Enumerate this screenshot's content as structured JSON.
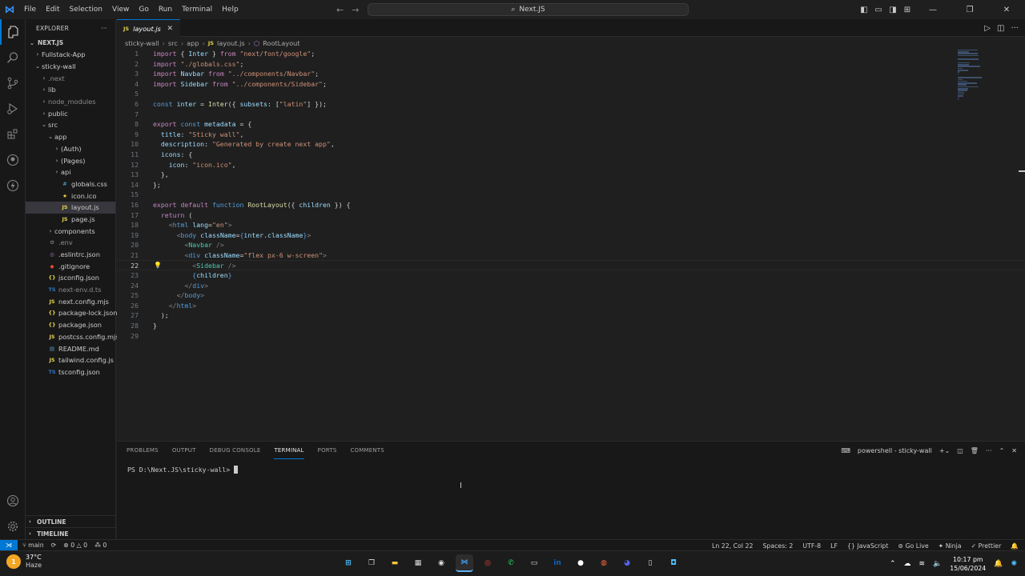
{
  "titlebar": {
    "menu": [
      "File",
      "Edit",
      "Selection",
      "View",
      "Go",
      "Run",
      "Terminal",
      "Help"
    ],
    "search": "Next.JS"
  },
  "explorer": {
    "title": "EXPLORER",
    "root": "NEXT.JS",
    "items": [
      {
        "label": "Fullstack-App",
        "depth": 1,
        "type": "folder",
        "open": false
      },
      {
        "label": "sticky-wall",
        "depth": 1,
        "type": "folder",
        "open": true
      },
      {
        "label": ".next",
        "depth": 2,
        "type": "folder",
        "open": false,
        "dim": true
      },
      {
        "label": "lib",
        "depth": 2,
        "type": "folder",
        "open": false
      },
      {
        "label": "node_modules",
        "depth": 2,
        "type": "folder",
        "open": false,
        "dim": true
      },
      {
        "label": "public",
        "depth": 2,
        "type": "folder",
        "open": false
      },
      {
        "label": "src",
        "depth": 2,
        "type": "folder",
        "open": true
      },
      {
        "label": "app",
        "depth": 3,
        "type": "folder",
        "open": true
      },
      {
        "label": "(Auth)",
        "depth": 4,
        "type": "folder",
        "open": false
      },
      {
        "label": "(Pages)",
        "depth": 4,
        "type": "folder",
        "open": false
      },
      {
        "label": "api",
        "depth": 4,
        "type": "folder",
        "open": false
      },
      {
        "label": "globals.css",
        "depth": 4,
        "type": "css"
      },
      {
        "label": "icon.ico",
        "depth": 4,
        "type": "ico"
      },
      {
        "label": "layout.js",
        "depth": 4,
        "type": "js",
        "selected": true
      },
      {
        "label": "page.js",
        "depth": 4,
        "type": "js"
      },
      {
        "label": "components",
        "depth": 3,
        "type": "folder",
        "open": false
      },
      {
        "label": ".env",
        "depth": 2,
        "type": "env",
        "dim": true
      },
      {
        "label": ".eslintrc.json",
        "depth": 2,
        "type": "eslint"
      },
      {
        "label": ".gitignore",
        "depth": 2,
        "type": "git"
      },
      {
        "label": "jsconfig.json",
        "depth": 2,
        "type": "json"
      },
      {
        "label": "next-env.d.ts",
        "depth": 2,
        "type": "ts",
        "dim": true
      },
      {
        "label": "next.config.mjs",
        "depth": 2,
        "type": "js"
      },
      {
        "label": "package-lock.json",
        "depth": 2,
        "type": "json"
      },
      {
        "label": "package.json",
        "depth": 2,
        "type": "json"
      },
      {
        "label": "postcss.config.mjs",
        "depth": 2,
        "type": "js"
      },
      {
        "label": "README.md",
        "depth": 2,
        "type": "md"
      },
      {
        "label": "tailwind.config.js",
        "depth": 2,
        "type": "js"
      },
      {
        "label": "tsconfig.json",
        "depth": 2,
        "type": "ts"
      }
    ],
    "outline": "OUTLINE",
    "timeline": "TIMELINE"
  },
  "editor": {
    "tab": "layout.js",
    "breadcrumb": [
      "sticky-wall",
      "src",
      "app",
      "layout.js",
      "RootLayout"
    ],
    "current_line": 22,
    "lines": [
      [
        [
          "kw",
          "import "
        ],
        [
          "p",
          "{ "
        ],
        [
          "v",
          "Inter"
        ],
        [
          "p",
          " } "
        ],
        [
          "kw",
          "from "
        ],
        [
          "s",
          "\"next/font/google\""
        ],
        [
          "p",
          ";"
        ]
      ],
      [
        [
          "kw",
          "import "
        ],
        [
          "s",
          "\"./globals.css\""
        ],
        [
          "p",
          ";"
        ]
      ],
      [
        [
          "kw",
          "import "
        ],
        [
          "v",
          "Navbar "
        ],
        [
          "kw",
          "from "
        ],
        [
          "s",
          "\"../components/Navbar\""
        ],
        [
          "p",
          ";"
        ]
      ],
      [
        [
          "kw",
          "import "
        ],
        [
          "v",
          "Sidebar "
        ],
        [
          "kw",
          "from "
        ],
        [
          "s",
          "\"../components/Sidebar\""
        ],
        [
          "p",
          ";"
        ]
      ],
      [],
      [
        [
          "b",
          "const "
        ],
        [
          "v",
          "inter "
        ],
        [
          "p",
          "= "
        ],
        [
          "f",
          "Inter"
        ],
        [
          "p",
          "({ "
        ],
        [
          "v",
          "subsets"
        ],
        [
          "p",
          ": ["
        ],
        [
          "s",
          "\"latin\""
        ],
        [
          "p",
          "] });"
        ]
      ],
      [],
      [
        [
          "kw",
          "export "
        ],
        [
          "b",
          "const "
        ],
        [
          "v",
          "metadata "
        ],
        [
          "p",
          "= {"
        ]
      ],
      [
        [
          "p",
          "  "
        ],
        [
          "v",
          "title"
        ],
        [
          "p",
          ": "
        ],
        [
          "s",
          "\"Sticky wall\""
        ],
        [
          "p",
          ","
        ]
      ],
      [
        [
          "p",
          "  "
        ],
        [
          "v",
          "description"
        ],
        [
          "p",
          ": "
        ],
        [
          "s",
          "\"Generated by create next app\""
        ],
        [
          "p",
          ","
        ]
      ],
      [
        [
          "p",
          "  "
        ],
        [
          "v",
          "icons"
        ],
        [
          "p",
          ": {"
        ]
      ],
      [
        [
          "p",
          "    "
        ],
        [
          "v",
          "icon"
        ],
        [
          "p",
          ": "
        ],
        [
          "s",
          "\"icon.ico\""
        ],
        [
          "p",
          ","
        ]
      ],
      [
        [
          "p",
          "  },"
        ]
      ],
      [
        [
          "p",
          "};"
        ]
      ],
      [],
      [
        [
          "kw",
          "export default "
        ],
        [
          "b",
          "function "
        ],
        [
          "f",
          "RootLayout"
        ],
        [
          "p",
          "({ "
        ],
        [
          "v",
          "children"
        ],
        [
          "p",
          " }) {"
        ]
      ],
      [
        [
          "p",
          "  "
        ],
        [
          "kw",
          "return "
        ],
        [
          "p",
          "("
        ]
      ],
      [
        [
          "p",
          "    "
        ],
        [
          "t",
          "<"
        ],
        [
          "tn",
          "html "
        ],
        [
          "a",
          "lang"
        ],
        [
          "p",
          "="
        ],
        [
          "s",
          "\"en\""
        ],
        [
          "t",
          ">"
        ]
      ],
      [
        [
          "p",
          "      "
        ],
        [
          "t",
          "<"
        ],
        [
          "tn",
          "body "
        ],
        [
          "a",
          "className"
        ],
        [
          "p",
          "="
        ],
        [
          "b",
          "{"
        ],
        [
          "v",
          "inter"
        ],
        [
          "p",
          "."
        ],
        [
          "v",
          "className"
        ],
        [
          "b",
          "}"
        ],
        [
          "t",
          ">"
        ]
      ],
      [
        [
          "p",
          "        "
        ],
        [
          "t",
          "<"
        ],
        [
          "c",
          "Navbar "
        ],
        [
          "t",
          "/>"
        ]
      ],
      [
        [
          "p",
          "        "
        ],
        [
          "t",
          "<"
        ],
        [
          "tn",
          "div "
        ],
        [
          "a",
          "className"
        ],
        [
          "p",
          "="
        ],
        [
          "s",
          "\"flex px-6 w-screen\""
        ],
        [
          "t",
          ">"
        ]
      ],
      [
        [
          "p",
          "          "
        ],
        [
          "t",
          "<"
        ],
        [
          "c",
          "Sidebar "
        ],
        [
          "t",
          "/>"
        ]
      ],
      [
        [
          "p",
          "          "
        ],
        [
          "b",
          "{"
        ],
        [
          "v",
          "children"
        ],
        [
          "b",
          "}"
        ]
      ],
      [
        [
          "p",
          "        "
        ],
        [
          "t",
          "</"
        ],
        [
          "tn",
          "div"
        ],
        [
          "t",
          ">"
        ]
      ],
      [
        [
          "p",
          "      "
        ],
        [
          "t",
          "</"
        ],
        [
          "tn",
          "body"
        ],
        [
          "t",
          ">"
        ]
      ],
      [
        [
          "p",
          "    "
        ],
        [
          "t",
          "</"
        ],
        [
          "tn",
          "html"
        ],
        [
          "t",
          ">"
        ]
      ],
      [
        [
          "p",
          "  );"
        ]
      ],
      [
        [
          "p",
          "}"
        ]
      ],
      []
    ]
  },
  "panel": {
    "tabs": [
      "PROBLEMS",
      "OUTPUT",
      "DEBUG CONSOLE",
      "TERMINAL",
      "PORTS",
      "COMMENTS"
    ],
    "active_tab": "TERMINAL",
    "shell": "powershell - sticky-wall",
    "prompt": "PS D:\\Next.JS\\sticky-wall>"
  },
  "statusbar": {
    "branch": "main",
    "errors": "0",
    "warnings": "0",
    "ports": "0",
    "position": "Ln 22, Col 22",
    "spaces": "Spaces: 2",
    "encoding": "UTF-8",
    "eol": "LF",
    "language": "JavaScript",
    "golive": "Go Live",
    "ninja": "Ninja",
    "prettier": "Prettier"
  },
  "taskbar": {
    "temp": "37°C",
    "weather": "Haze",
    "notification_count": "1",
    "time": "10:17 pm",
    "date": "15/06/2024"
  },
  "colors": {
    "accent": "#0078d4",
    "kw": "#c586c0",
    "b": "#569cd6",
    "v": "#9cdcfe",
    "f": "#dcdcaa",
    "s": "#ce9178",
    "p": "#d4d4d4",
    "t": "#808080",
    "tn": "#569cd6",
    "a": "#9cdcfe",
    "c": "#4ec9b0"
  }
}
